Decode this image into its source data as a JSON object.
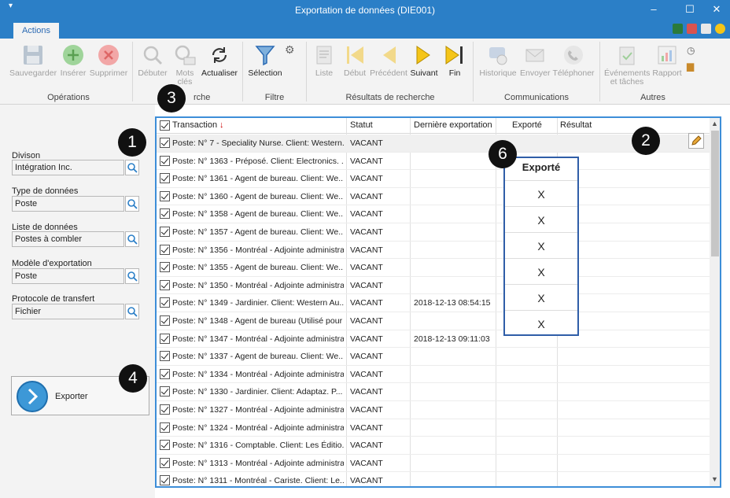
{
  "window": {
    "title": "Exportation de données (DIE001)"
  },
  "tabs": [
    {
      "label": "Actions"
    }
  ],
  "ribbon": {
    "groups": [
      {
        "label": "Opérations",
        "buttons": [
          {
            "label": "Sauvegarder",
            "icon": "save-icon",
            "enabled": false
          },
          {
            "label": "Insérer",
            "icon": "plus-icon",
            "enabled": false
          },
          {
            "label": "Supprimer",
            "icon": "delete-icon",
            "enabled": false
          }
        ]
      },
      {
        "label": "Recherche",
        "buttons": [
          {
            "label": "Débuter",
            "icon": "magnifier-icon",
            "enabled": false
          },
          {
            "label": "Mots clés",
            "icon": "keyword-search-icon",
            "enabled": false
          },
          {
            "label": "Actualiser",
            "icon": "refresh-icon",
            "enabled": true
          }
        ]
      },
      {
        "label": "Filtre",
        "buttons": [
          {
            "label": "Sélection",
            "icon": "filter-icon",
            "enabled": true
          }
        ]
      },
      {
        "label": "Résultats de recherche",
        "buttons": [
          {
            "label": "Liste",
            "icon": "list-icon",
            "enabled": false
          },
          {
            "label": "Début",
            "icon": "first-icon",
            "enabled": false
          },
          {
            "label": "Précédent",
            "icon": "previous-icon",
            "enabled": false
          },
          {
            "label": "Suivant",
            "icon": "next-icon",
            "enabled": true
          },
          {
            "label": "Fin",
            "icon": "last-icon",
            "enabled": true
          }
        ]
      },
      {
        "label": "Communications",
        "buttons": [
          {
            "label": "Historique",
            "icon": "history-icon",
            "enabled": false
          },
          {
            "label": "Envoyer",
            "icon": "envelope-icon",
            "enabled": false
          },
          {
            "label": "Téléphoner",
            "icon": "phone-icon",
            "enabled": false
          }
        ]
      },
      {
        "label": "Autres",
        "buttons": [
          {
            "label": "Événements et tâches",
            "icon": "clipboard-icon",
            "enabled": false
          },
          {
            "label": "Rapport",
            "icon": "report-icon",
            "enabled": false
          }
        ]
      }
    ]
  },
  "filters": [
    {
      "label": "Divison",
      "value": "Intégration Inc."
    },
    {
      "label": "Type de données",
      "value": "Poste"
    },
    {
      "label": "Liste de données",
      "value": "Postes à combler"
    },
    {
      "label": "Modèle d'exportation",
      "value": "Poste"
    },
    {
      "label": "Protocole de transfert",
      "value": "Fichier"
    }
  ],
  "export_button": {
    "label": "Exporter"
  },
  "grid": {
    "columns": [
      "Transaction",
      "Statut",
      "Dernière exportation",
      "Exporté",
      "Résultat"
    ],
    "rows": [
      {
        "transaction": "Poste: N° 7 - Speciality Nurse.  Client: Western...",
        "statut": "VACANT",
        "date": ""
      },
      {
        "transaction": "Poste: N° 1363 - Préposé.  Client: Electronics. ...",
        "statut": "VACANT",
        "date": ""
      },
      {
        "transaction": "Poste: N° 1361 - Agent de bureau.  Client: We...",
        "statut": "VACANT",
        "date": ""
      },
      {
        "transaction": "Poste: N° 1360 - Agent de bureau.  Client: We...",
        "statut": "VACANT",
        "date": ""
      },
      {
        "transaction": "Poste: N° 1358 - Agent de bureau.  Client: We...",
        "statut": "VACANT",
        "date": ""
      },
      {
        "transaction": "Poste: N° 1357 - Agent de bureau.  Client: We...",
        "statut": "VACANT",
        "date": ""
      },
      {
        "transaction": "Poste: N° 1356 - Montréal - Adjointe administra...",
        "statut": "VACANT",
        "date": ""
      },
      {
        "transaction": "Poste: N° 1355 - Agent de bureau.  Client: We...",
        "statut": "VACANT",
        "date": ""
      },
      {
        "transaction": "Poste: N° 1350 - Montréal - Adjointe administra...",
        "statut": "VACANT",
        "date": ""
      },
      {
        "transaction": "Poste: N° 1349 - Jardinier.  Client: Western Au...",
        "statut": "VACANT",
        "date": "2018-12-13 08:54:15"
      },
      {
        "transaction": "Poste: N° 1348 - Agent de bureau (Utilisé pour ...",
        "statut": "VACANT",
        "date": ""
      },
      {
        "transaction": "Poste: N° 1347 - Montréal - Adjointe administra...",
        "statut": "VACANT",
        "date": "2018-12-13 09:11:03"
      },
      {
        "transaction": "Poste: N° 1337 - Agent de bureau.  Client: We...",
        "statut": "VACANT",
        "date": ""
      },
      {
        "transaction": "Poste: N° 1334 - Montréal - Adjointe administra...",
        "statut": "VACANT",
        "date": ""
      },
      {
        "transaction": "Poste: N° 1330 - Jardinier.  Client: Adaptaz.  P...",
        "statut": "VACANT",
        "date": ""
      },
      {
        "transaction": "Poste: N° 1327 - Montréal - Adjointe administra...",
        "statut": "VACANT",
        "date": ""
      },
      {
        "transaction": "Poste: N° 1324 - Montréal - Adjointe administra...",
        "statut": "VACANT",
        "date": ""
      },
      {
        "transaction": "Poste: N° 1316 - Comptable.  Client: Les Éditio...",
        "statut": "VACANT",
        "date": ""
      },
      {
        "transaction": "Poste: N° 1313 - Montréal - Adjointe administra...",
        "statut": "VACANT",
        "date": ""
      },
      {
        "transaction": "Poste: N° 1311 - Montréal - Cariste.  Client: Le...",
        "statut": "VACANT",
        "date": ""
      }
    ]
  },
  "callouts": [
    "1",
    "2",
    "3",
    "4",
    "6"
  ],
  "zoom_panel": {
    "header": "Exporté",
    "marks": [
      "X",
      "X",
      "X",
      "X",
      "X",
      "X"
    ]
  },
  "colors": {
    "accent": "#2b7fc7",
    "grid_border": "#3d8ed8",
    "callout": "#111111"
  }
}
